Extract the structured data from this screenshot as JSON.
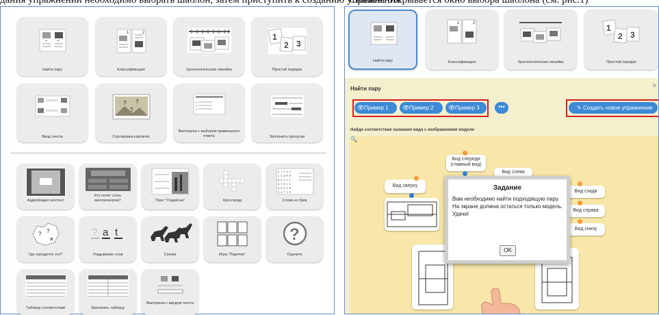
{
  "top_strip": {
    "left_text": "дания упражнений необходимо выбрать шаблон, затем приступить к созданию упражнения",
    "right_text": "Сначала открывается окно выбора шаблона (см. рис.1)"
  },
  "left_panel": {
    "row1": [
      "Найти пару",
      "Классификация",
      "Хронологическая линейка",
      "Простой порядок"
    ],
    "row2": [
      "Ввод текста",
      "Сортировка картинок",
      "Викторина с выбором правильного ответа",
      "Заполнить пропуски"
    ],
    "row3": [
      "Аудио/видео контент",
      "Кто хочет стать миллионером?",
      "Пазл \"Угадай-ка\"",
      "Кроссворд",
      "Слова из букв"
    ],
    "row4": [
      "Где находится это?",
      "Угадывание слов",
      "Скачки",
      "Игра \"Парочки\"",
      "Оцените"
    ],
    "row5": [
      "Таблица соответствий",
      "Заполнить таблицу",
      "Викторина с вводом текста"
    ],
    "thumb_text": {
      "ordering_digits": [
        "1",
        "2",
        "3"
      ],
      "classify_digits": [
        "1",
        "2"
      ],
      "word_letters": [
        "a",
        "t"
      ]
    }
  },
  "right_panel": {
    "tiles": [
      "Найти пару",
      "Классификация",
      "Хронологическая линейка",
      "Простой порядок"
    ],
    "exercise_title": "Найти пару",
    "examples": [
      "Пример 1",
      "Пример 2",
      "Пример 3"
    ],
    "more_label": "•••",
    "create_label": "Создать новое упражнение",
    "task_description": "Найди соответствие названия вида с изображением модели",
    "cards": [
      "Вид спереди (главный вид)",
      "Вид слева",
      "Вид сверху",
      "Вид сзади",
      "Вид справа",
      "Вид снизу"
    ],
    "modal": {
      "title": "Задание",
      "text": "Вам необходимо найти подходящую пару. На экране должна остаться только модель. Удачи!",
      "ok_label": "OK"
    }
  },
  "colors": {
    "accent": "#3d8ad6",
    "highlight": "#d42020",
    "board": "#f8e7a9"
  }
}
